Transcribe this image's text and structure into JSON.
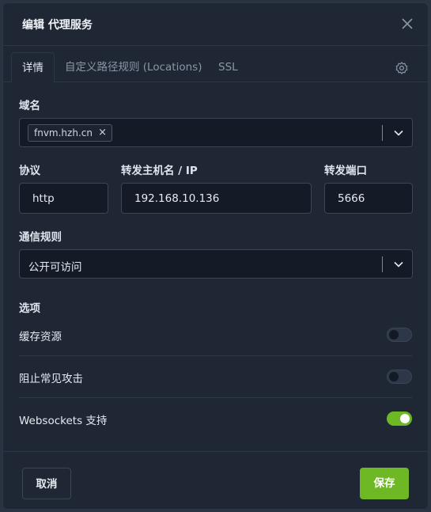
{
  "dialog": {
    "title": "编辑 代理服务"
  },
  "tabs": [
    {
      "label": "详情",
      "active": true
    },
    {
      "label": "自定义路径规则 (Locations)",
      "active": false
    },
    {
      "label": "SSL",
      "active": false
    }
  ],
  "domain": {
    "label": "域名",
    "chips": [
      "fnvm.hzh.cn"
    ],
    "chip_remove": "×"
  },
  "protocol": {
    "label": "协议",
    "value": "http"
  },
  "forward_host": {
    "label": "转发主机名 / IP",
    "value": "192.168.10.136"
  },
  "forward_port": {
    "label": "转发端口",
    "value": "5666"
  },
  "access_rule": {
    "label": "通信规则",
    "value": "公开可访问"
  },
  "options": {
    "label": "选项",
    "items": [
      {
        "label": "缓存资源",
        "enabled": false
      },
      {
        "label": "阻止常见攻击",
        "enabled": false
      },
      {
        "label": "Websockets 支持",
        "enabled": true
      }
    ]
  },
  "footer": {
    "cancel_label": "取消",
    "save_label": "保存"
  },
  "colors": {
    "accent": "#6fb825",
    "background": "#1f2735",
    "input_bg": "#141b27"
  }
}
